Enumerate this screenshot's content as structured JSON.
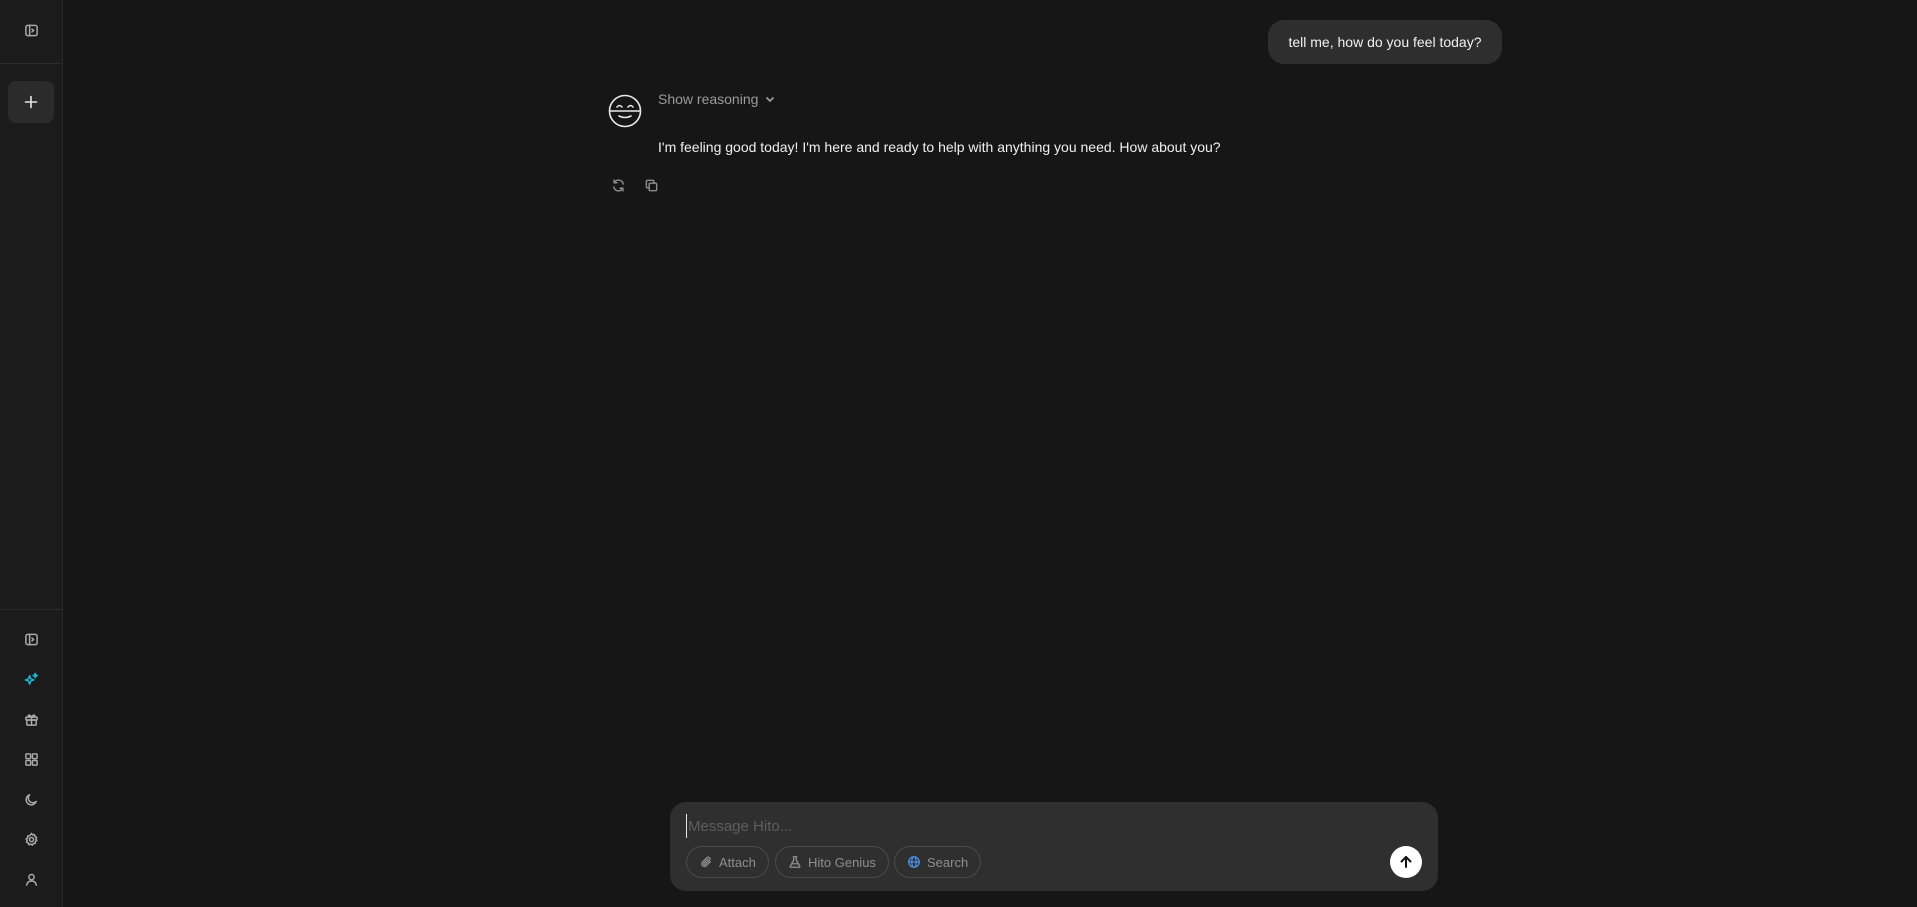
{
  "sidebar": {
    "toggle_icon": "sidebar-toggle-icon",
    "new_chat_icon": "plus-icon",
    "bottom_icons": [
      "panel-icon",
      "sparkles-icon",
      "gift-icon",
      "apps-grid-icon",
      "moon-icon",
      "gear-icon",
      "user-icon"
    ],
    "accent_color": "#1bb6d6"
  },
  "conversation": {
    "user_message": "tell me, how do you feel today?",
    "assistant": {
      "reasoning_label": "Show reasoning",
      "reply": "I'm feeling good today! I'm here and ready to help with anything you need. How about you?"
    }
  },
  "composer": {
    "placeholder": "Message Hito...",
    "value": "",
    "attach_label": "Attach",
    "genius_label": "Hito Genius",
    "search_label": "Search"
  },
  "colors": {
    "background": "#161616",
    "sidebar": "#1b1b1b",
    "bubble": "#2e2e2e",
    "composer": "#2f2f2f",
    "search_accent": "#4a90e2"
  }
}
